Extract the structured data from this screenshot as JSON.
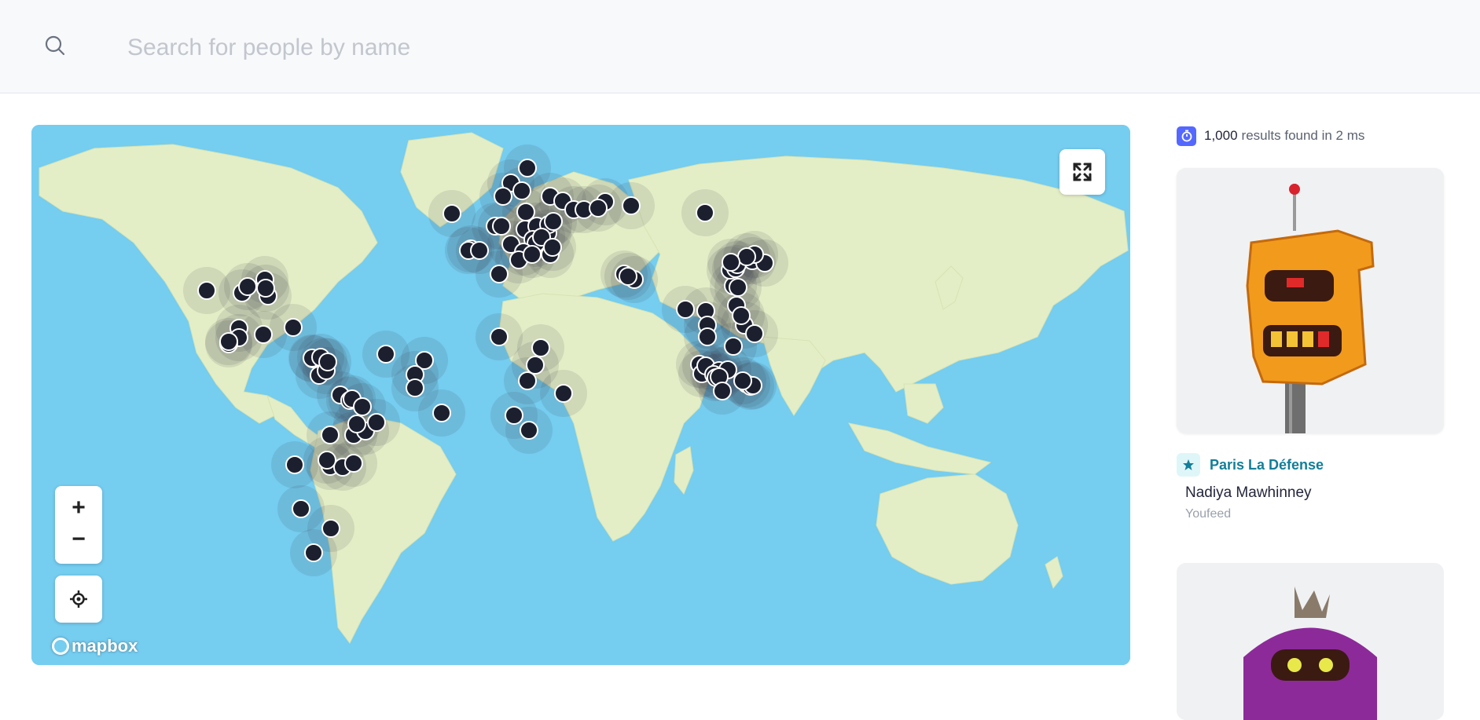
{
  "search": {
    "placeholder": "Search for people by name",
    "value": ""
  },
  "map": {
    "attribution": "mapbox",
    "controls": {
      "zoom_in": "+",
      "zoom_out": "−"
    }
  },
  "colors": {
    "water": "#75cdf0",
    "land": "#e3edc4",
    "marker": "#1b1f2e",
    "accent": "#5468ff",
    "location_text": "#137e99"
  },
  "icons": [
    "search-icon",
    "fullscreen-icon",
    "locate-icon",
    "stopwatch-icon",
    "star-icon"
  ],
  "results": {
    "count": "1,000",
    "label": "results found in 2 ms"
  },
  "cards": [
    {
      "location": "Paris La Défense",
      "name": "Nadiya Mawhinney",
      "company": "Youfeed"
    }
  ]
}
